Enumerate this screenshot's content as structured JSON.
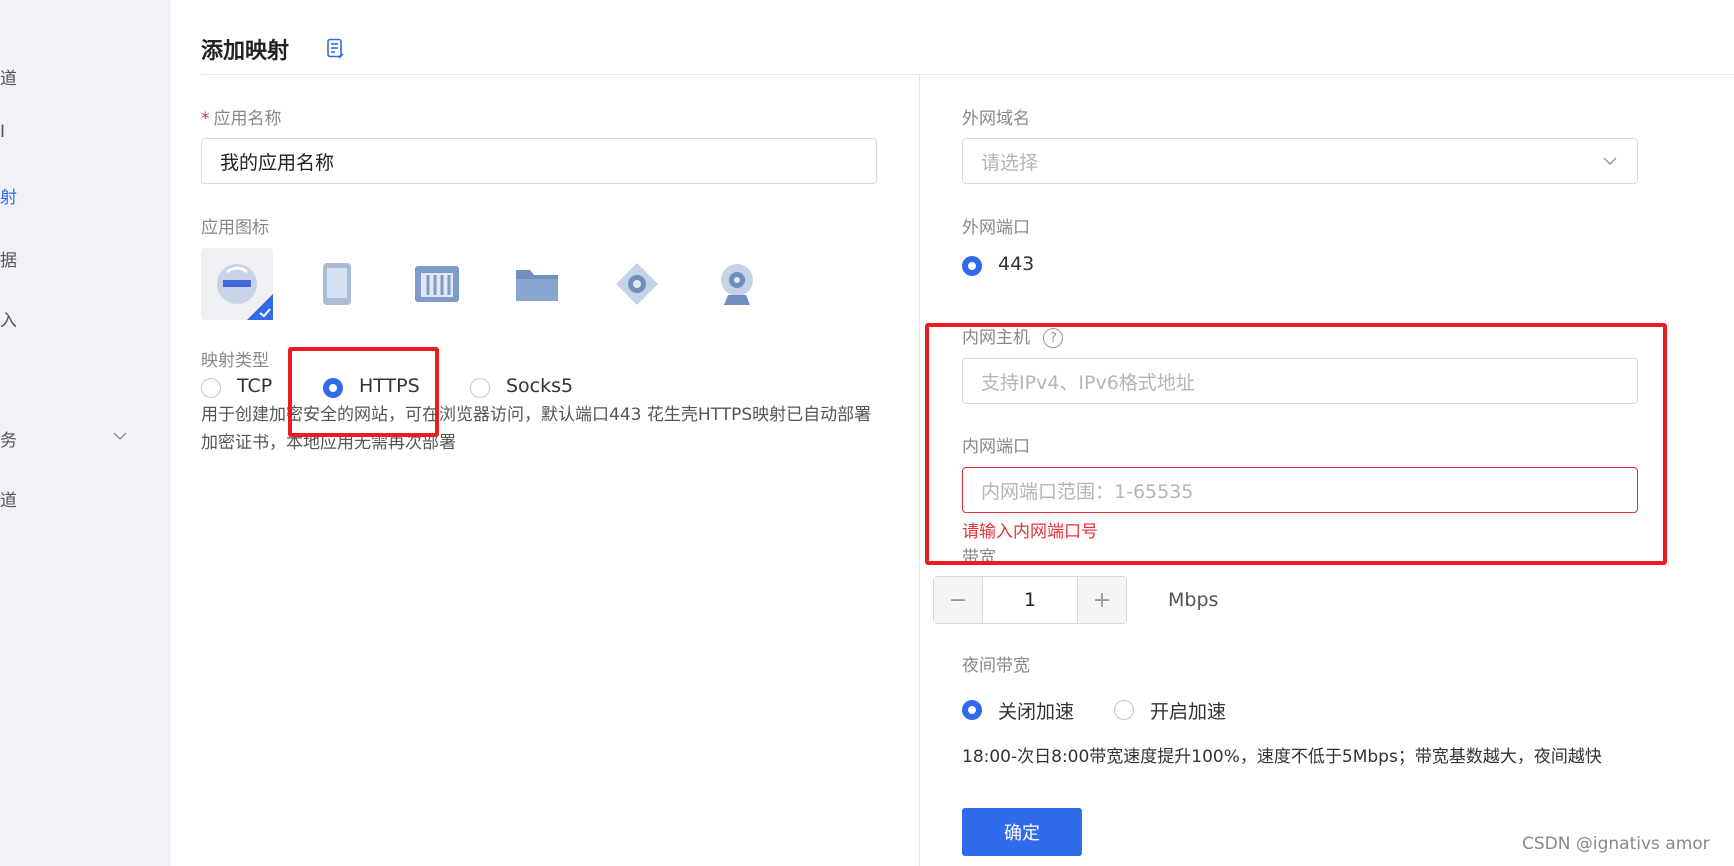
{
  "sidebar": {
    "items": [
      {
        "label": "道",
        "color": "#666666"
      },
      {
        "label": "Ⅰ",
        "color": "#666666"
      },
      {
        "label": "射",
        "color": "#2f6bea"
      },
      {
        "label": "据",
        "color": "#666666"
      },
      {
        "label": "入",
        "color": "#666666"
      },
      {
        "label": "务",
        "color": "#666666"
      },
      {
        "label": "道",
        "color": "#666666"
      }
    ]
  },
  "page": {
    "title": "添加映射"
  },
  "left": {
    "app_name_label": "应用名称",
    "required_mark": "*",
    "app_name_value": "我的应用名称",
    "app_icon_label": "应用图标",
    "mapping_type_label": "映射类型",
    "mapping_types": [
      "TCP",
      "HTTPS",
      "Socks5"
    ],
    "selected_mapping": "HTTPS",
    "description": "用于创建加密安全的网站，可在浏览器访问，默认端口443 花生壳HTTPS映射已自动部署加密证书，本地应用无需再次部署"
  },
  "right": {
    "domain_label": "外网域名",
    "domain_placeholder": "请选择",
    "ext_port_label": "外网端口",
    "ext_port_value": "443",
    "host_label": "内网主机",
    "host_help": "?",
    "host_placeholder": "支持IPv4、IPv6格式地址",
    "int_port_label": "内网端口",
    "int_port_placeholder": "内网端口范围：1-65535",
    "int_port_error": "请输入内网端口号",
    "bandwidth_label": "带宽",
    "bandwidth_value": "1",
    "bandwidth_unit": "Mbps",
    "night_label": "夜间带宽",
    "night_options": [
      "关闭加速",
      "开启加速"
    ],
    "night_selected": "关闭加速",
    "night_desc": "18:00-次日8:00带宽速度提升100%，速度不低于5Mbps；带宽基数越大，夜间越快",
    "confirm_label": "确定"
  },
  "watermark": "CSDN @ignativs  amor",
  "colors": {
    "accent": "#2f6bea",
    "error": "#e6333b",
    "highlight": "#ec1c1c"
  }
}
